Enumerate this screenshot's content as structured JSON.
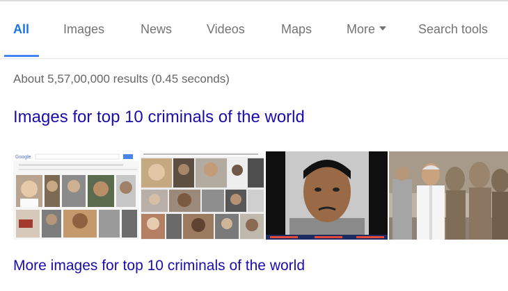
{
  "tabs": [
    {
      "label": "All",
      "active": true
    },
    {
      "label": "Images"
    },
    {
      "label": "News"
    },
    {
      "label": "Videos"
    },
    {
      "label": "Maps"
    },
    {
      "label": "More"
    },
    {
      "label": "Search tools"
    }
  ],
  "results_stats": "About 5,57,00,000 results (0.45 seconds)",
  "images_heading": "Images for top 10 criminals of the world",
  "thumbnails": [
    {
      "description": "search results page screenshot collage",
      "logo_text": "Google"
    },
    {
      "description": "collage of portrait photos"
    },
    {
      "description": "mugshot of man with mustache"
    },
    {
      "description": "man in white by statues"
    }
  ],
  "more_images_link": "More images for top 10 criminals of the world",
  "colors": {
    "link": "#1a0dab",
    "active_tab": "#1a73e8",
    "underline": "#4285f4",
    "muted_text": "#737373"
  }
}
